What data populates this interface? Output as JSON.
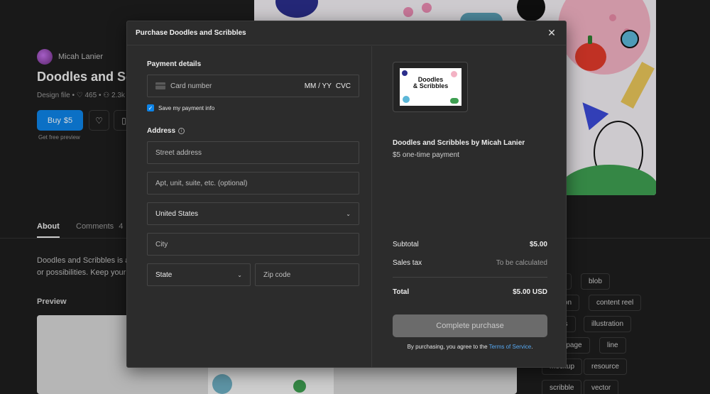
{
  "background_page": {
    "author": "Micah Lanier",
    "file_title": "Doodles and Sc",
    "meta": "Design file • ♡ 465 • ⚇ 2.3k",
    "buy_label": "Buy",
    "buy_price": "$5",
    "free_preview": "Get free preview",
    "tabs": [
      {
        "label": "About"
      },
      {
        "label": "Comments",
        "count": "4"
      }
    ],
    "description_line1": "Doodles and Scribbles is a",
    "description_line2": "or possibilities. Keep your c",
    "preview_label": "Preview",
    "tags": [
      "s",
      "blob",
      "tion",
      "content reel",
      "es",
      "illustration",
      "g page",
      "line",
      "mockup",
      "resource",
      "scribble",
      "vector"
    ]
  },
  "modal": {
    "title": "Purchase Doodles and Scribbles",
    "payment": {
      "section_label": "Payment details",
      "card_placeholder": "Card number",
      "expiry_placeholder": "MM / YY",
      "cvc_placeholder": "CVC",
      "save_info_label": "Save my payment info",
      "save_info_checked": true
    },
    "address": {
      "section_label": "Address",
      "street_placeholder": "Street address",
      "apt_placeholder": "Apt, unit, suite, etc. (optional)",
      "country_value": "United States",
      "city_placeholder": "City",
      "state_value": "State",
      "zip_placeholder": "Zip code"
    },
    "product": {
      "thumb_title_line1": "Doodles",
      "thumb_title_line2": "& Scribbles",
      "name": "Doodles and Scribbles by Micah Lanier",
      "price_note": "$5 one-time payment"
    },
    "summary": {
      "subtotal_label": "Subtotal",
      "subtotal_value": "$5.00",
      "tax_label": "Sales tax",
      "tax_value": "To be calculated",
      "total_label": "Total",
      "total_value": "$5.00 USD"
    },
    "complete_label": "Complete purchase",
    "terms_prefix": "By purchasing, you agree to the",
    "terms_link": "Terms of Service",
    "terms_suffix": "."
  },
  "colors": {
    "accent": "#0d84e8",
    "link": "#56a7f0",
    "modal_bg": "#2c2c2c",
    "page_bg": "#1e1e1e"
  }
}
